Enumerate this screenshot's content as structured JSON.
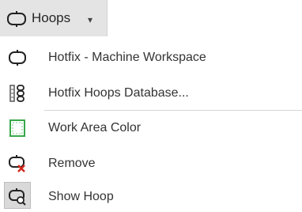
{
  "ribbon": {
    "button_label": "Hoops",
    "button_icon": "hoop-icon",
    "dropdown_icon": "caret-down-icon",
    "caret_glyph": "▾"
  },
  "menu": {
    "items": [
      {
        "label": "Hotfix - Machine Workspace",
        "icon": "hoop-icon"
      },
      {
        "label": "Hotfix Hoops Database...",
        "icon": "database-list-icon"
      },
      {
        "label": "Work Area Color",
        "icon": "work-area-icon"
      },
      {
        "label": "Remove",
        "icon": "remove-hoop-icon"
      },
      {
        "label": "Show Hoop",
        "icon": "show-hoop-icon"
      }
    ]
  },
  "colors": {
    "ribbon_background": "#e4e4e4",
    "text": "#333333",
    "icon_stroke": "#222222",
    "work_area_green": "#3aa84a",
    "remove_red": "#d42a1e",
    "separator": "#d6d6d6"
  }
}
